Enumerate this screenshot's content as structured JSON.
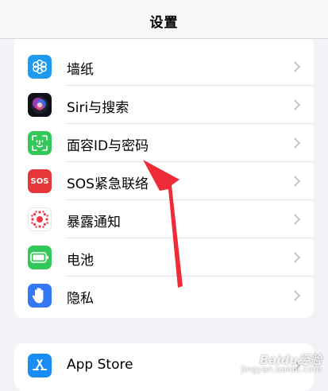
{
  "header": {
    "title": "设置"
  },
  "settings_list": {
    "items": [
      {
        "label": "墙纸",
        "icon": "wallpaper-icon",
        "color": "#1c9bf0"
      },
      {
        "label": "Siri与搜索",
        "icon": "siri-icon",
        "color": "#1a1a2e"
      },
      {
        "label": "面容ID与密码",
        "icon": "face-id-icon",
        "color": "#34c759"
      },
      {
        "label": "SOS紧急联络",
        "icon": "sos-icon",
        "color": "#e5383b",
        "icon_text": "SOS"
      },
      {
        "label": "暴露通知",
        "icon": "exposure-notification-icon",
        "color": "#ffffff"
      },
      {
        "label": "电池",
        "icon": "battery-icon",
        "color": "#34c759"
      },
      {
        "label": "隐私",
        "icon": "hand-privacy-icon",
        "color": "#3478f6"
      }
    ]
  },
  "store_group": {
    "items": [
      {
        "label": "App Store",
        "icon": "app-store-icon",
        "color": "#1a8cf5"
      }
    ]
  },
  "watermark": {
    "brand": "Baidu经验",
    "url": "jingyan.baidu.com"
  },
  "annotation": {
    "color": "#ef2b38"
  }
}
